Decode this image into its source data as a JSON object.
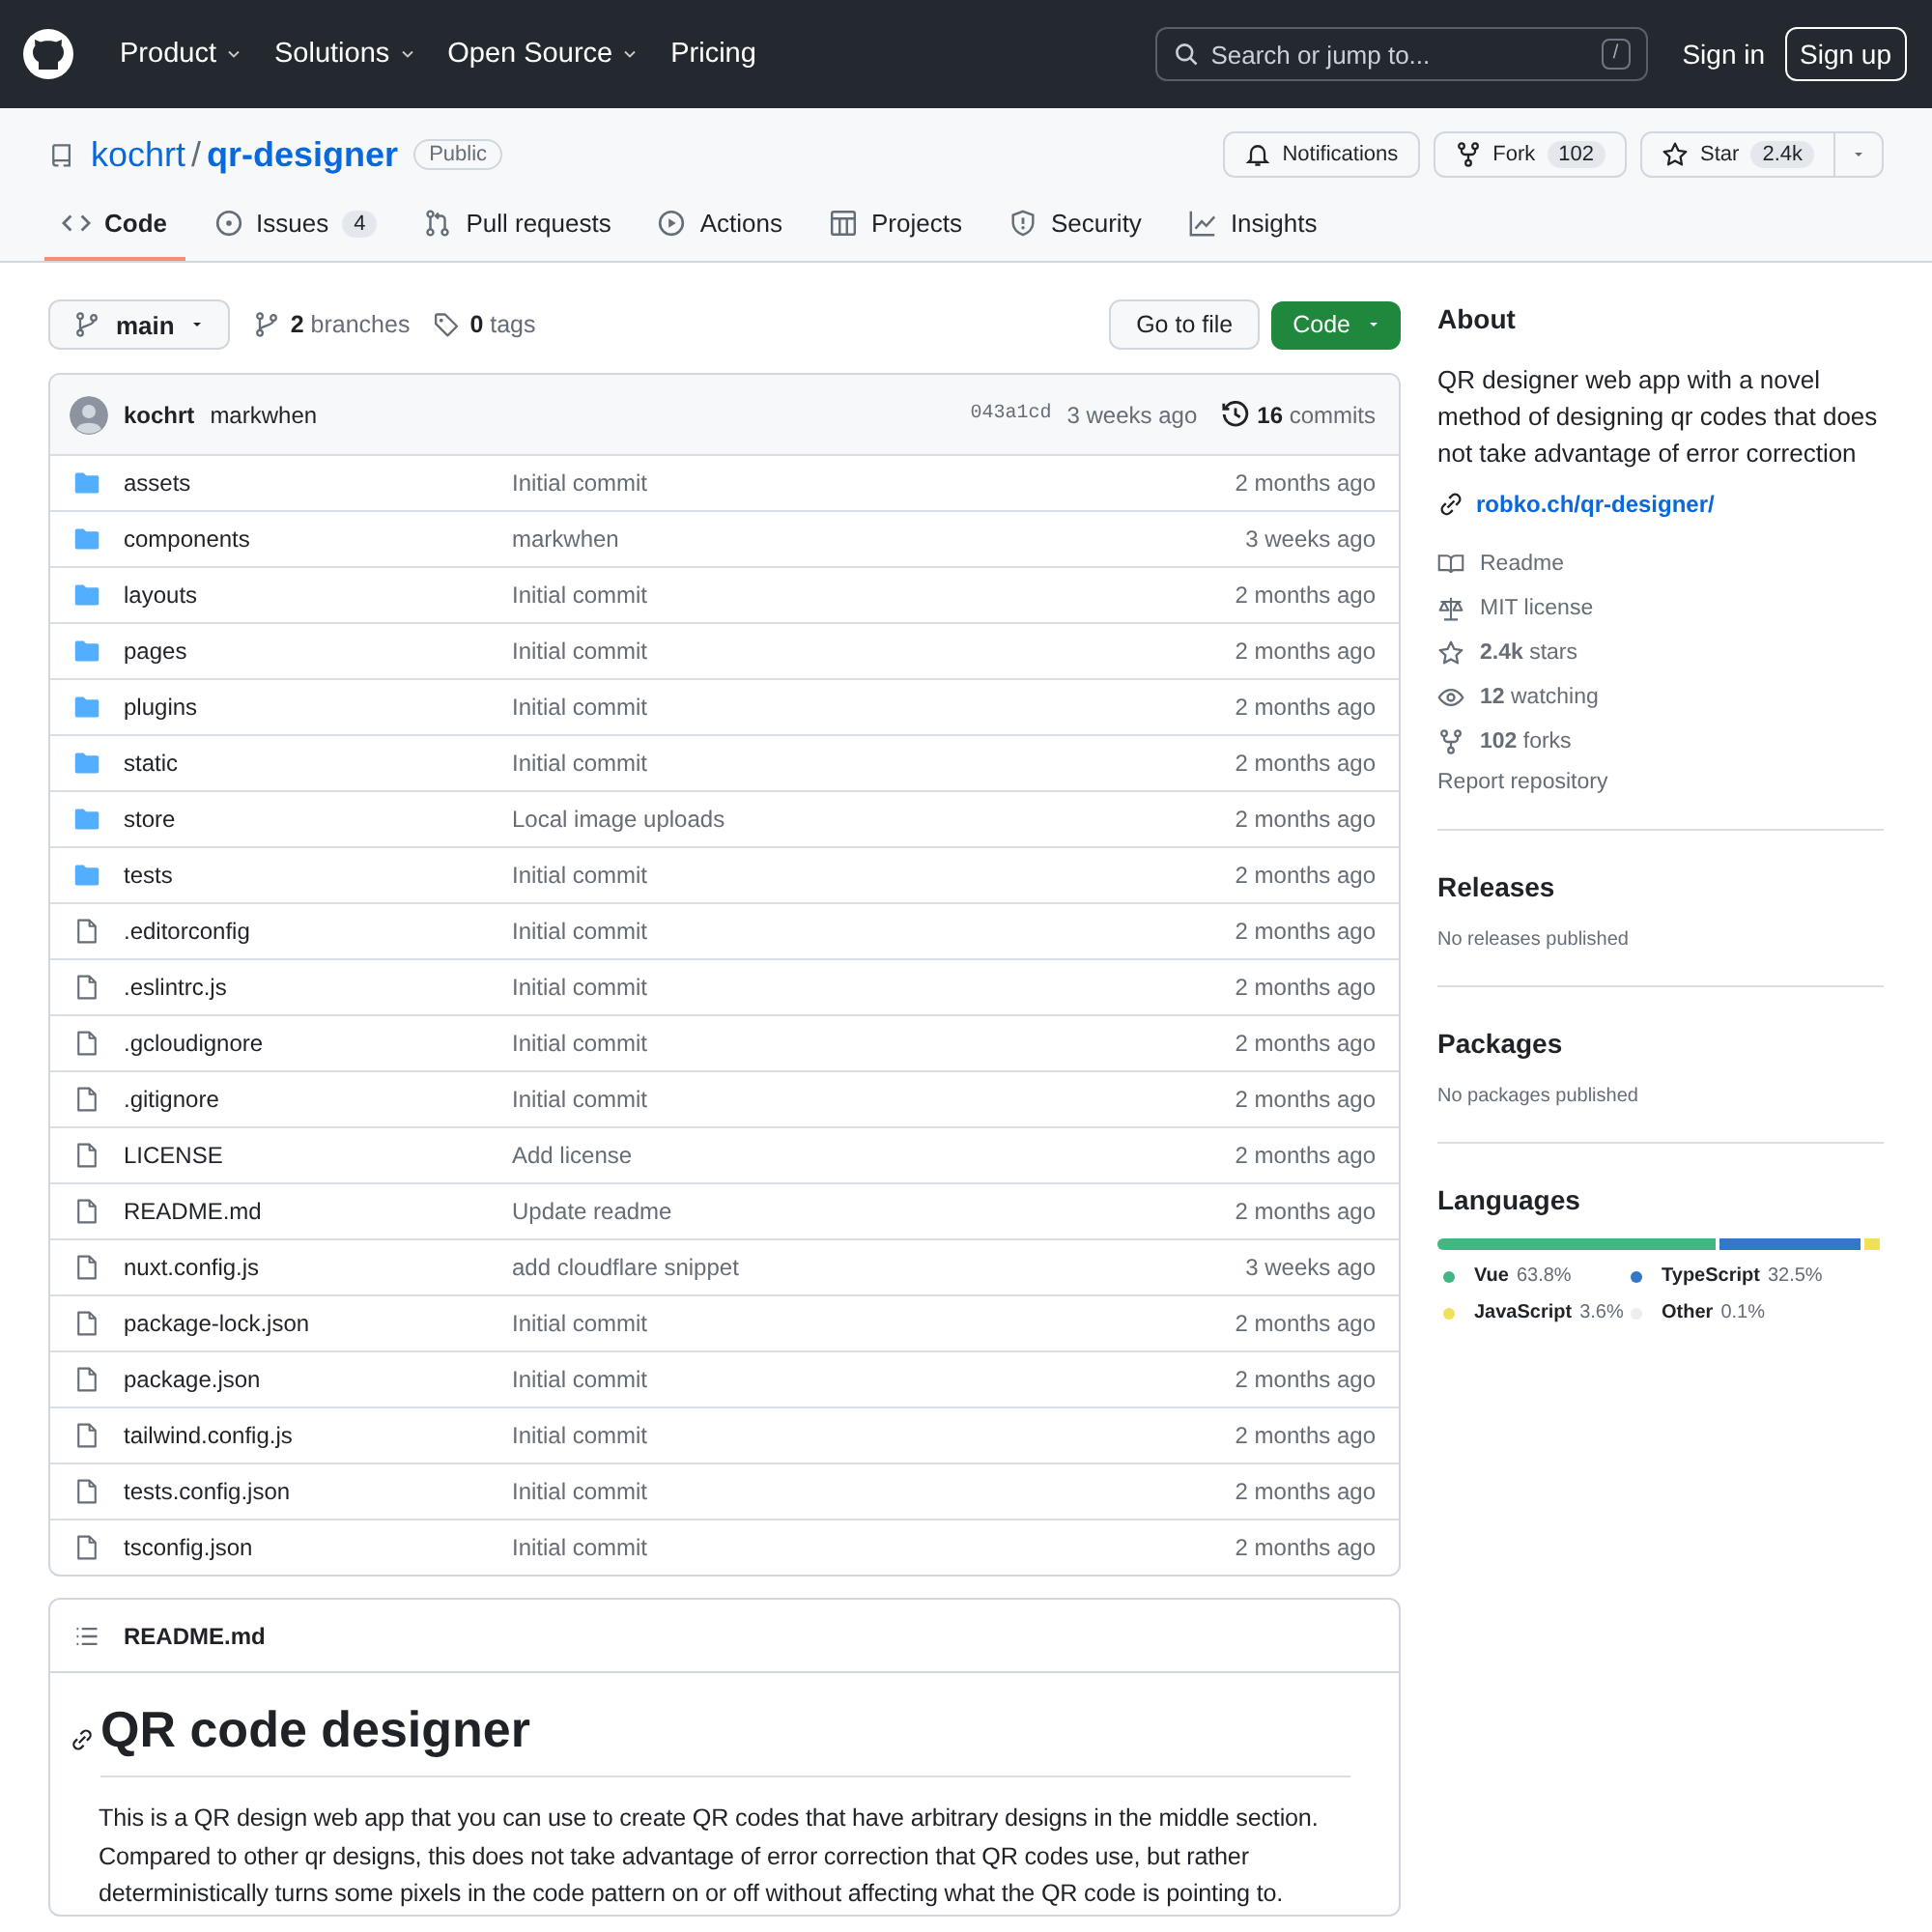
{
  "header": {
    "nav": [
      {
        "label": "Product",
        "caret": true
      },
      {
        "label": "Solutions",
        "caret": true
      },
      {
        "label": "Open Source",
        "caret": true
      },
      {
        "label": "Pricing",
        "caret": false
      }
    ],
    "search": {
      "placeholder": "Search or jump to...",
      "key": "/"
    },
    "sign_in": "Sign in",
    "sign_up": "Sign up"
  },
  "repo": {
    "owner": "kochrt",
    "separator": "/",
    "name": "qr-designer",
    "visibility": "Public",
    "actions": [
      {
        "kind": "notifications",
        "label": "Notifications"
      },
      {
        "kind": "fork",
        "label": "Fork",
        "count": "102"
      },
      {
        "kind": "star",
        "label": "Star",
        "count": "2.4k"
      }
    ]
  },
  "tabs": [
    {
      "kind": "code",
      "label": "Code",
      "selected": true
    },
    {
      "kind": "issues",
      "label": "Issues",
      "count": "4",
      "selected": false
    },
    {
      "kind": "pr",
      "label": "Pull requests",
      "selected": false
    },
    {
      "kind": "actions",
      "label": "Actions",
      "selected": false
    },
    {
      "kind": "projects",
      "label": "Projects",
      "selected": false
    },
    {
      "kind": "security",
      "label": "Security",
      "selected": false
    },
    {
      "kind": "insights",
      "label": "Insights",
      "selected": false
    }
  ],
  "branch_bar": {
    "branch": "main",
    "branches": "**2** branches",
    "tags": "**0** tags",
    "go_to_file": "Go to file",
    "code_button": "Code"
  },
  "commit": {
    "author": "kochrt",
    "message": "markwhen",
    "hash": "043a1cd",
    "time": "3 weeks ago",
    "commits": "**16** commits"
  },
  "files": [
    {
      "kind": "dir",
      "name": "assets",
      "message": "Initial commit",
      "time": "2 months ago"
    },
    {
      "kind": "dir",
      "name": "components",
      "message": "markwhen",
      "time": "3 weeks ago"
    },
    {
      "kind": "dir",
      "name": "layouts",
      "message": "Initial commit",
      "time": "2 months ago"
    },
    {
      "kind": "dir",
      "name": "pages",
      "message": "Initial commit",
      "time": "2 months ago"
    },
    {
      "kind": "dir",
      "name": "plugins",
      "message": "Initial commit",
      "time": "2 months ago"
    },
    {
      "kind": "dir",
      "name": "static",
      "message": "Initial commit",
      "time": "2 months ago"
    },
    {
      "kind": "dir",
      "name": "store",
      "message": "Local image uploads",
      "time": "2 months ago"
    },
    {
      "kind": "dir",
      "name": "tests",
      "message": "Initial commit",
      "time": "2 months ago"
    },
    {
      "kind": "file",
      "name": ".editorconfig",
      "message": "Initial commit",
      "time": "2 months ago"
    },
    {
      "kind": "file",
      "name": ".eslintrc.js",
      "message": "Initial commit",
      "time": "2 months ago"
    },
    {
      "kind": "file",
      "name": ".gcloudignore",
      "message": "Initial commit",
      "time": "2 months ago"
    },
    {
      "kind": "file",
      "name": ".gitignore",
      "message": "Initial commit",
      "time": "2 months ago"
    },
    {
      "kind": "file",
      "name": "LICENSE",
      "message": "Add license",
      "time": "2 months ago"
    },
    {
      "kind": "file",
      "name": "README.md",
      "message": "Update readme",
      "time": "2 months ago"
    },
    {
      "kind": "file",
      "name": "nuxt.config.js",
      "message": "add cloudflare snippet",
      "time": "3 weeks ago"
    },
    {
      "kind": "file",
      "name": "package-lock.json",
      "message": "Initial commit",
      "time": "2 months ago"
    },
    {
      "kind": "file",
      "name": "package.json",
      "message": "Initial commit",
      "time": "2 months ago"
    },
    {
      "kind": "file",
      "name": "tailwind.config.js",
      "message": "Initial commit",
      "time": "2 months ago"
    },
    {
      "kind": "file",
      "name": "tests.config.json",
      "message": "Initial commit",
      "time": "2 months ago"
    },
    {
      "kind": "file",
      "name": "tsconfig.json",
      "message": "Initial commit",
      "time": "2 months ago"
    }
  ],
  "readme": {
    "file": "README.md",
    "heading": "QR code designer",
    "paragraph": "This is a QR design web app that you can use to create QR codes that have arbitrary designs in the middle section. Compared to other qr designs, this does not take advantage of error correction that QR codes use, but rather deterministically turns some pixels in the code pattern on or off without affecting what the QR code is pointing to."
  },
  "about": {
    "heading": "About",
    "description": "QR designer web app with a novel method of designing qr codes that does not take advantage of error correction",
    "link": "robko.ch/qr-designer/",
    "meta": [
      {
        "kind": "readme",
        "text": "Readme"
      },
      {
        "kind": "license",
        "text": "MIT license"
      },
      {
        "kind": "stars",
        "text": "**2.4k** stars"
      },
      {
        "kind": "watching",
        "text": "**12** watching"
      },
      {
        "kind": "forks",
        "text": "**102** forks"
      }
    ],
    "report": "Report repository"
  },
  "releases": {
    "heading": "Releases",
    "note": "No releases published"
  },
  "packages": {
    "heading": "Packages",
    "note": "No packages published"
  },
  "languages": {
    "heading": "Languages",
    "items": [
      {
        "name": "Vue",
        "percent": "63.8%",
        "color": "#41b883"
      },
      {
        "name": "TypeScript",
        "percent": "32.5%",
        "color": "#3178c6"
      },
      {
        "name": "JavaScript",
        "percent": "3.6%",
        "color": "#f1e05a"
      },
      {
        "name": "Other",
        "percent": "0.1%",
        "color": "#ededed"
      }
    ]
  }
}
